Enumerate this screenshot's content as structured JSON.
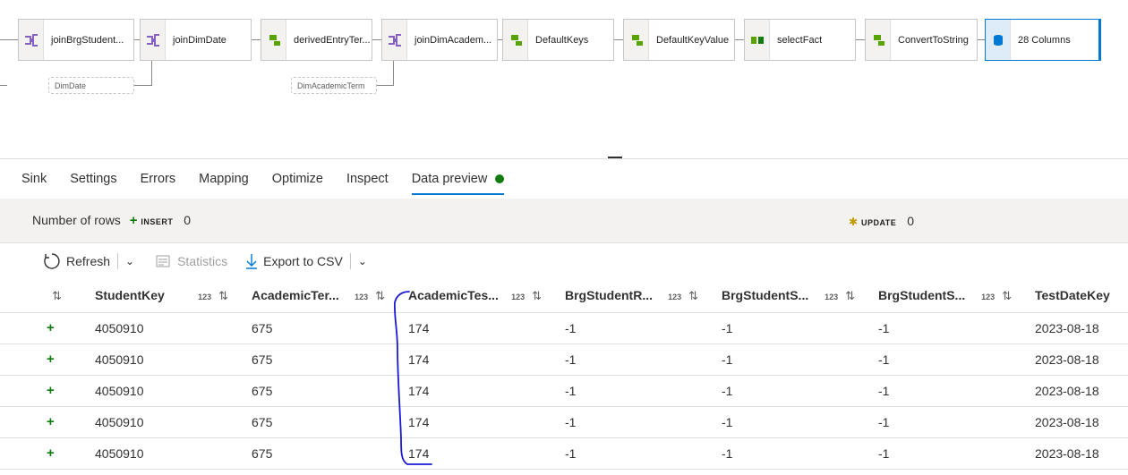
{
  "flow": {
    "nodes": [
      {
        "label": "joinBrgStudent...",
        "icon": "join-icon"
      },
      {
        "label": "joinDimDate",
        "icon": "join-icon"
      },
      {
        "label": "derivedEntryTer...",
        "icon": "derived-column-icon"
      },
      {
        "label": "joinDimAcadem...",
        "icon": "join-icon"
      },
      {
        "label": "DefaultKeys",
        "icon": "derived-column-icon"
      },
      {
        "label": "DefaultKeyValue",
        "icon": "derived-column-icon"
      },
      {
        "label": "selectFact",
        "icon": "select-icon"
      },
      {
        "label": "ConvertToString",
        "icon": "derived-column-icon"
      },
      {
        "label": "28 Columns",
        "icon": "sink-database-icon"
      }
    ],
    "side_inputs": [
      "DimDate",
      "DimAcademicTerm"
    ]
  },
  "tabs": [
    {
      "label": "Sink"
    },
    {
      "label": "Settings"
    },
    {
      "label": "Errors"
    },
    {
      "label": "Mapping"
    },
    {
      "label": "Optimize"
    },
    {
      "label": "Inspect"
    },
    {
      "label": "Data preview",
      "active": true
    }
  ],
  "rows_summary": {
    "caption": "Number of rows",
    "insert_label": "INSERT",
    "insert_count": "0",
    "update_label": "UPDATE",
    "update_count": "0"
  },
  "toolbar": {
    "refresh": "Refresh",
    "statistics": "Statistics",
    "export": "Export to CSV"
  },
  "table": {
    "type_badge": "123",
    "columns": [
      "StudentKey",
      "AcademicTer...",
      "AcademicTes...",
      "BrgStudentR...",
      "BrgStudentS...",
      "BrgStudentS...",
      "TestDateKey"
    ],
    "rows": [
      [
        "4050910",
        "675",
        "174",
        "-1",
        "-1",
        "-1",
        "2023-08-18"
      ],
      [
        "4050910",
        "675",
        "174",
        "-1",
        "-1",
        "-1",
        "2023-08-18"
      ],
      [
        "4050910",
        "675",
        "174",
        "-1",
        "-1",
        "-1",
        "2023-08-18"
      ],
      [
        "4050910",
        "675",
        "174",
        "-1",
        "-1",
        "-1",
        "2023-08-18"
      ],
      [
        "4050910",
        "675",
        "174",
        "-1",
        "-1",
        "-1",
        "2023-08-18"
      ]
    ]
  },
  "colors": {
    "accent": "#0078d4",
    "insert": "#107c10",
    "update": "#c19c00",
    "join": "#8661c5",
    "derived": "#57a300",
    "annotation": "#1a1ad6"
  }
}
